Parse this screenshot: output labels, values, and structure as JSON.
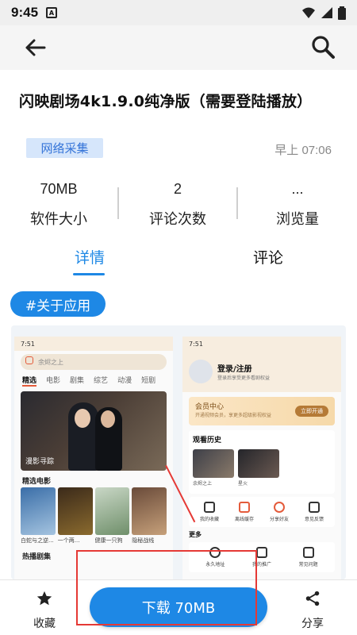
{
  "statusbar": {
    "time": "9:45",
    "notif": "A"
  },
  "app": {
    "title": "闪映剧场4k1.9.0纯净版（需要登陆播放）",
    "badge": "网络采集",
    "timestamp": "早上 07:06"
  },
  "stats": [
    {
      "value": "70MB",
      "label": "软件大小"
    },
    {
      "value": "2",
      "label": "评论次数"
    },
    {
      "value": "...",
      "label": "浏览量"
    }
  ],
  "tabs": [
    {
      "label": "详情",
      "active": true
    },
    {
      "label": "评论",
      "active": false
    }
  ],
  "section_pill": "#关于应用",
  "screenshot": {
    "phone1": {
      "time": "7:51",
      "search_placeholder": "余烬之上",
      "categories": [
        "精选",
        "电影",
        "剧集",
        "综艺",
        "动漫",
        "短剧"
      ],
      "banner_caption": "漫影寻踪",
      "section_movies": "精选电影",
      "movie_captions": [
        "白蛇与之逆...",
        "一个两...",
        "健康一只狗",
        "隐秘战线"
      ],
      "section_dramas": "热播剧集"
    },
    "phone2": {
      "time": "7:51",
      "login_title": "登录/注册",
      "login_sub": "登录后享受更多看剧权益",
      "vip_title": "会员中心",
      "vip_sub": "开通视频会员，享更多超级影视权益",
      "vip_btn": "立即开通",
      "history_title": "观看历史",
      "history_items": [
        "余烬之上",
        "星火"
      ],
      "grid": [
        "我的收藏",
        "离线缓存",
        "分享好友",
        "意见反馈"
      ],
      "more_title": "更多",
      "more_items": [
        "永久地址",
        "我的推广",
        "常见问题"
      ]
    }
  },
  "bottombar": {
    "favorite_label": "收藏",
    "download_label": "下载 70MB",
    "share_label": "分享"
  },
  "colors": {
    "accent": "#1e88e5",
    "badge_bg": "#d6e6fb",
    "highlight": "#e53935"
  }
}
